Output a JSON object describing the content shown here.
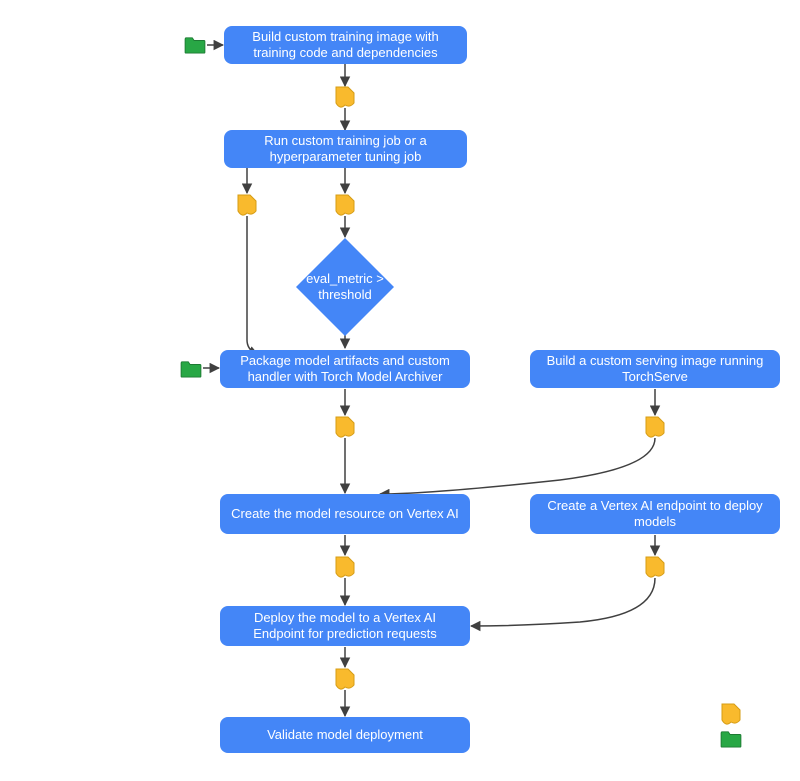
{
  "colors": {
    "box": "#4486f7",
    "doc_fill": "#f9ba2d",
    "doc_stroke": "#d69c14",
    "folder_fill": "#28a745",
    "folder_stroke": "#1d7a33",
    "arrow": "#404040"
  },
  "nodes": {
    "build_training": "Build custom training image with training code and dependencies",
    "run_training": "Run custom training job or a hyperparameter tuning job",
    "decision": "eval_metric > threshold",
    "package_model": "Package model artifacts and custom handler with Torch Model Archiver",
    "build_serving": "Build a custom serving image running TorchServe",
    "create_model": "Create the model resource on Vertex AI",
    "create_endpoint": "Create a Vertex AI endpoint to deploy models",
    "deploy_model": "Deploy the model to a Vertex AI Endpoint for prediction requests",
    "validate": "Validate model deployment"
  },
  "icons": {
    "folder": "folder-icon",
    "doc": "doc-icon"
  }
}
